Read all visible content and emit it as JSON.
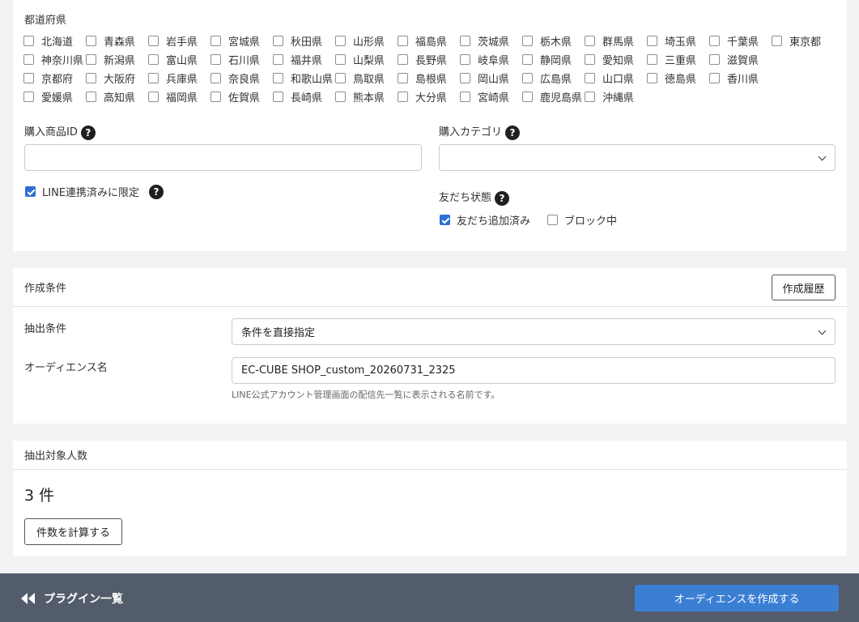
{
  "prefectures": {
    "title": "都道府県",
    "rows": [
      [
        "北海道",
        "青森県",
        "岩手県",
        "宮城県",
        "秋田県",
        "山形県",
        "福島県",
        "茨城県",
        "栃木県",
        "群馬県",
        "埼玉県",
        "千葉県",
        "東京都"
      ],
      [
        "神奈川県",
        "新潟県",
        "富山県",
        "石川県",
        "福井県",
        "山梨県",
        "長野県",
        "岐阜県",
        "静岡県",
        "愛知県",
        "三重県",
        "滋賀県"
      ],
      [
        "京都府",
        "大阪府",
        "兵庫県",
        "奈良県",
        "和歌山県",
        "鳥取県",
        "島根県",
        "岡山県",
        "広島県",
        "山口県",
        "徳島県",
        "香川県"
      ],
      [
        "愛媛県",
        "高知県",
        "福岡県",
        "佐賀県",
        "長崎県",
        "熊本県",
        "大分県",
        "宮崎県",
        "鹿児島県",
        "沖縄県"
      ]
    ]
  },
  "product_id": {
    "label": "購入商品ID",
    "value": ""
  },
  "category": {
    "label": "購入カテゴリ",
    "value": ""
  },
  "line_limit": {
    "label": "LINE連携済みに限定",
    "checked": true
  },
  "friend_status": {
    "label": "友だち状態",
    "options": [
      {
        "label": "友だち追加済み",
        "checked": true
      },
      {
        "label": "ブロック中",
        "checked": false
      }
    ]
  },
  "creation": {
    "title": "作成条件",
    "history_button": "作成履歴",
    "extract_label": "抽出条件",
    "extract_value": "条件を直接指定",
    "audience_label": "オーディエンス名",
    "audience_value": "EC-CUBE SHOP_custom_20260731_2325",
    "audience_hint": "LINE公式アカウント管理画面の配信先一覧に表示される名前です。"
  },
  "target": {
    "title": "抽出対象人数",
    "count": "3 件",
    "calc_button": "件数を計算する"
  },
  "footer": {
    "back_label": "プラグイン一覧",
    "submit_label": "オーディエンスを作成する"
  },
  "colors": {
    "accent": "#3b7fd4",
    "footer_bg": "#525c6b",
    "check": "#2f6fd6"
  },
  "icons": {
    "help": "question-circle-icon",
    "back": "double-chevron-left-icon",
    "select": "chevron-down-icon"
  }
}
